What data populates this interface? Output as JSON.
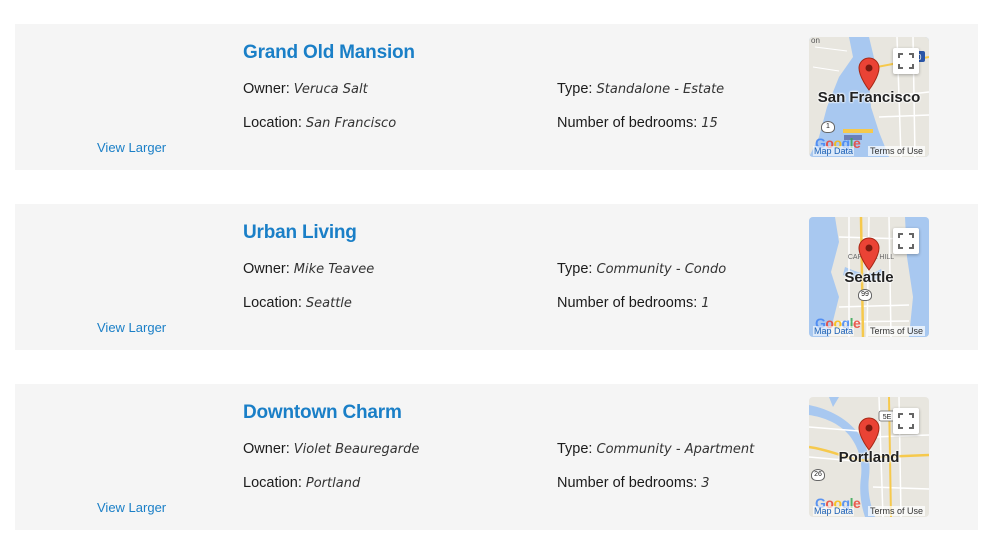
{
  "listings": [
    {
      "title": "Grand Old Mansion",
      "view_larger": "View Larger",
      "owner_label": "Owner:",
      "owner": "Veruca Salt",
      "location_label": "Location:",
      "location": "San Francisco",
      "type_label": "Type:",
      "type": "Standalone - Estate",
      "bedrooms_label": "Number of bedrooms:",
      "bedrooms": "15",
      "map": {
        "city_label": "San Francisco",
        "shield": "1",
        "corner_badge": "80",
        "map_data": "Map Data",
        "terms": "Terms of Use",
        "logo": "Google"
      }
    },
    {
      "title": "Urban Living",
      "view_larger": "View Larger",
      "owner_label": "Owner:",
      "owner": "Mike Teavee",
      "location_label": "Location:",
      "location": "Seattle",
      "type_label": "Type:",
      "type": "Community - Condo",
      "bedrooms_label": "Number of bedrooms:",
      "bedrooms": "1",
      "map": {
        "city_label": "Seattle",
        "district": "CAPITOL HILL",
        "shield": "99",
        "map_data": "Map Data",
        "terms": "Terms of Use",
        "logo": "Google"
      }
    },
    {
      "title": "Downtown Charm",
      "view_larger": "View Larger",
      "owner_label": "Owner:",
      "owner": "Violet Beauregarde",
      "location_label": "Location:",
      "location": "Portland",
      "type_label": "Type:",
      "type": "Community - Apartment",
      "bedrooms_label": "Number of bedrooms:",
      "bedrooms": "3",
      "map": {
        "city_label": "Portland",
        "shield": "26",
        "corner_badge": "5E",
        "map_data": "Map Data",
        "terms": "Terms of Use",
        "logo": "Google"
      }
    }
  ],
  "colors": {
    "link": "#1a7fc7",
    "card_bg": "#f5f5f5",
    "pin": "#ea4335",
    "water": "#a8c8f0",
    "land": "#e8e6df"
  }
}
